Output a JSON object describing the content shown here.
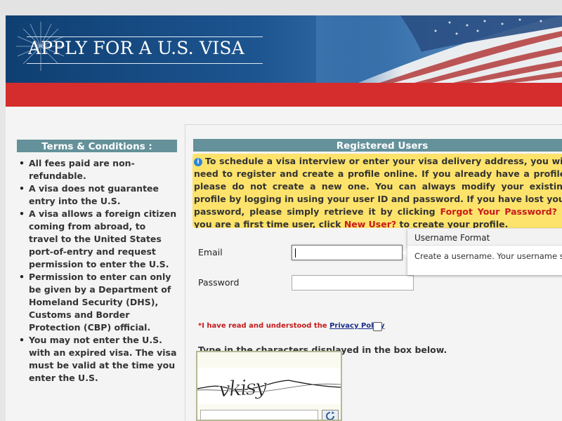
{
  "banner": {
    "title": "APPLY FOR A U.S. VISA"
  },
  "terms": {
    "header": "Terms & Conditions :",
    "items": [
      "All fees paid are non-refundable.",
      "A visa does not guarantee entry into the U.S.",
      "A visa allows a foreign citizen coming from abroad, to travel to the United States port-of-entry and request permission to enter the U.S.",
      "Permission to enter can only be given by a Department of Homeland Security (DHS), Customs and Border Protection (CBP) official.",
      "You may not enter the U.S. with an expired visa. The visa must be valid at the time you enter the U.S."
    ]
  },
  "registered": {
    "header": "Registered Users",
    "info": {
      "text1": "To schedule a visa interview or enter your visa delivery address, you will need to register and create a profile online. If you already have a profile, please do not create a new one. You can always modify your existing profile by logging in using your user ID and password. If you have lost your password, please simply retrieve it by clicking ",
      "forgot_link": "Forgot Your Password?",
      "text2": " If you are a first time user, click ",
      "new_user_link": "New User?",
      "text3": " to create your profile."
    }
  },
  "form": {
    "email_label": "Email",
    "email_value": "",
    "password_label": "Password",
    "password_value": "",
    "privacy_prefix": "*I have read and understood the ",
    "privacy_link": "Privacy Policy",
    "captcha_prompt": "Type in the characters displayed in the box below.",
    "captcha_value": "",
    "captcha_image_text": "vkisy"
  },
  "tooltip": {
    "title": "Username Format",
    "body": "Create a username. Your username should be in email address format (jane.doe@gmail.com)."
  },
  "colors": {
    "banner_blue": "#1d5590",
    "red_bar": "#d52d2d",
    "section_header": "#64919a",
    "info_yellow": "#fde36b",
    "link_red": "#c61a1a",
    "link_blue": "#1a2c8a"
  }
}
